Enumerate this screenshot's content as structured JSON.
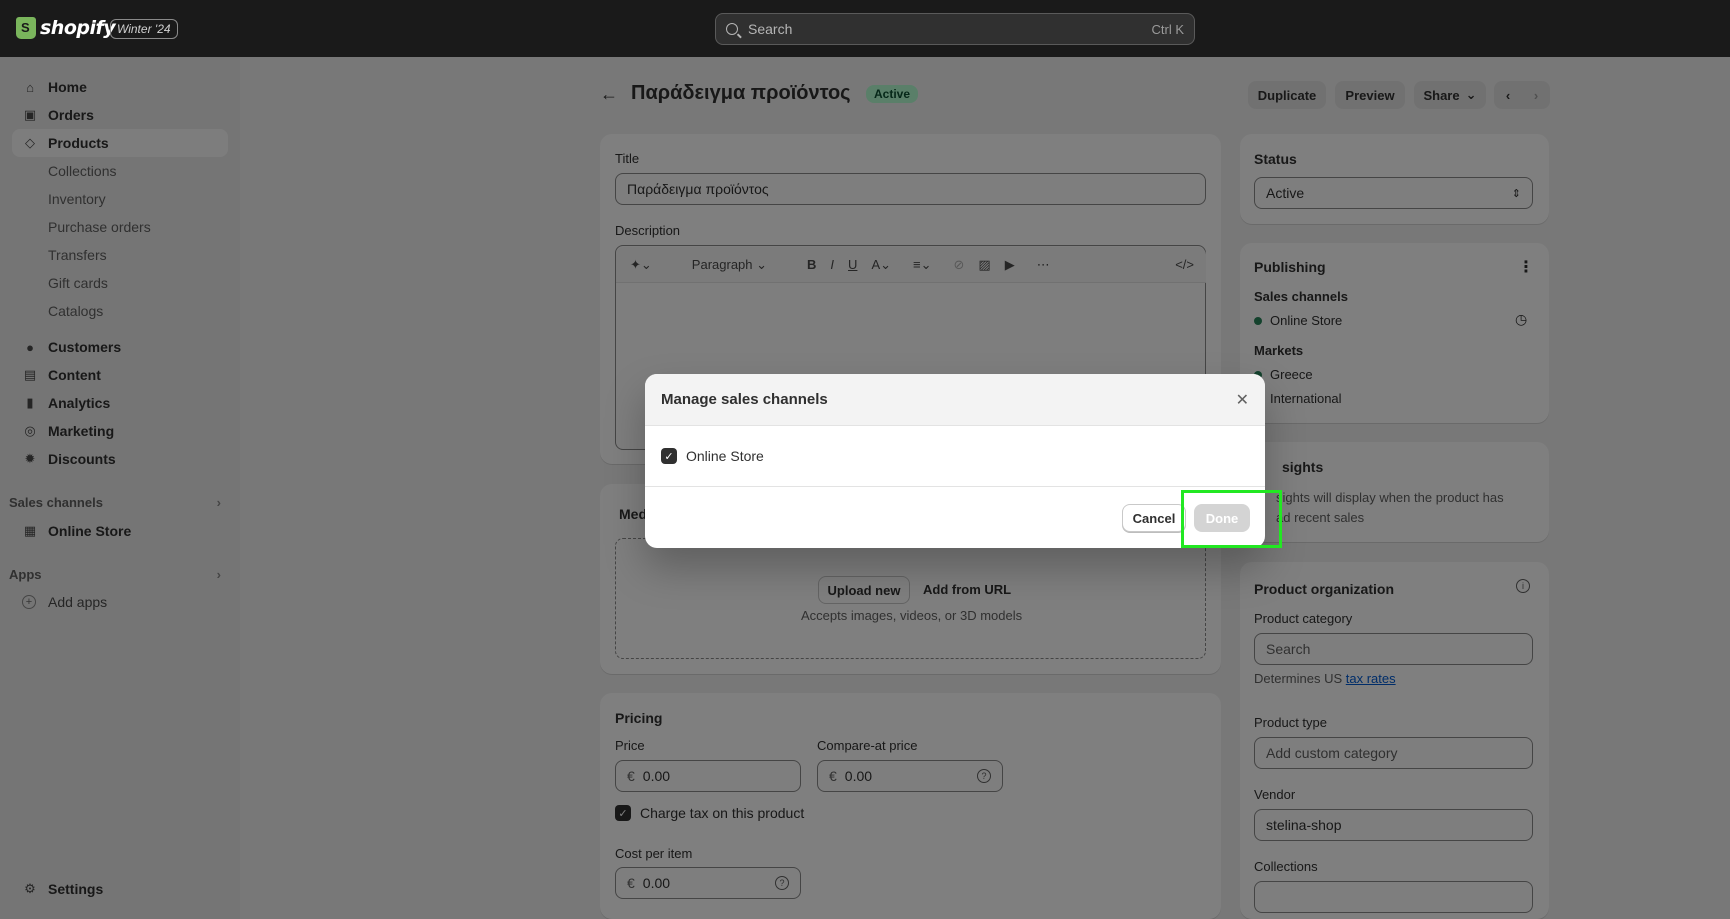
{
  "topbar": {
    "brand": "shopify",
    "edition": "Winter '24",
    "search_placeholder": "Search",
    "search_shortcut": "Ctrl K"
  },
  "sidebar": {
    "items": [
      {
        "label": "Home",
        "icon": "home-icon"
      },
      {
        "label": "Orders",
        "icon": "inbox-icon"
      },
      {
        "label": "Products",
        "icon": "tag-icon",
        "active": true
      }
    ],
    "product_sub": [
      "Collections",
      "Inventory",
      "Purchase orders",
      "Transfers",
      "Gift cards",
      "Catalogs"
    ],
    "items2": [
      {
        "label": "Customers",
        "icon": "person-icon"
      },
      {
        "label": "Content",
        "icon": "content-icon"
      },
      {
        "label": "Analytics",
        "icon": "bar-chart-icon"
      },
      {
        "label": "Marketing",
        "icon": "target-icon"
      },
      {
        "label": "Discounts",
        "icon": "discount-icon"
      }
    ],
    "sales_channels_label": "Sales channels",
    "online_store": "Online Store",
    "apps_label": "Apps",
    "add_apps": "Add apps",
    "settings": "Settings"
  },
  "header": {
    "title": "Παράδειγμα προϊόντος",
    "status_badge": "Active",
    "duplicate": "Duplicate",
    "preview": "Preview",
    "share": "Share"
  },
  "main": {
    "title_label": "Title",
    "title_value": "Παράδειγμα προϊόντος",
    "description_label": "Description",
    "toolbar_paragraph": "Paragraph",
    "media_label": "Med",
    "upload_new": "Upload new",
    "add_from_url": "Add from URL",
    "media_hint": "Accepts images, videos, or 3D models",
    "pricing_label": "Pricing",
    "price_label": "Price",
    "price_value": "0.00",
    "compare_label": "Compare-at price",
    "compare_value": "0.00",
    "currency": "€",
    "charge_tax": "Charge tax on this product",
    "cost_label": "Cost per item",
    "cost_value": "0.00"
  },
  "right": {
    "status_label": "Status",
    "status_value": "Active",
    "publishing_label": "Publishing",
    "sales_channels_label": "Sales channels",
    "online_store": "Online Store",
    "markets_label": "Markets",
    "market1": "Greece",
    "market2": "International",
    "insights_label": "sights",
    "insights_text1": "sights will display when the product has",
    "insights_text2": "ad recent sales",
    "org_label": "Product organization",
    "category_label": "Product category",
    "category_placeholder": "Search",
    "tax_hint": "Determines US",
    "tax_link": "tax rates",
    "type_label": "Product type",
    "type_placeholder": "Add custom category",
    "vendor_label": "Vendor",
    "vendor_value": "stelina-shop",
    "collections_label": "Collections"
  },
  "modal": {
    "title": "Manage sales channels",
    "option": "Online Store",
    "option_checked": true,
    "cancel": "Cancel",
    "done": "Done"
  },
  "colors": {
    "topbar": "#1a1a1a",
    "highlight": "#22e822",
    "active_badge": "#b4fed2"
  }
}
